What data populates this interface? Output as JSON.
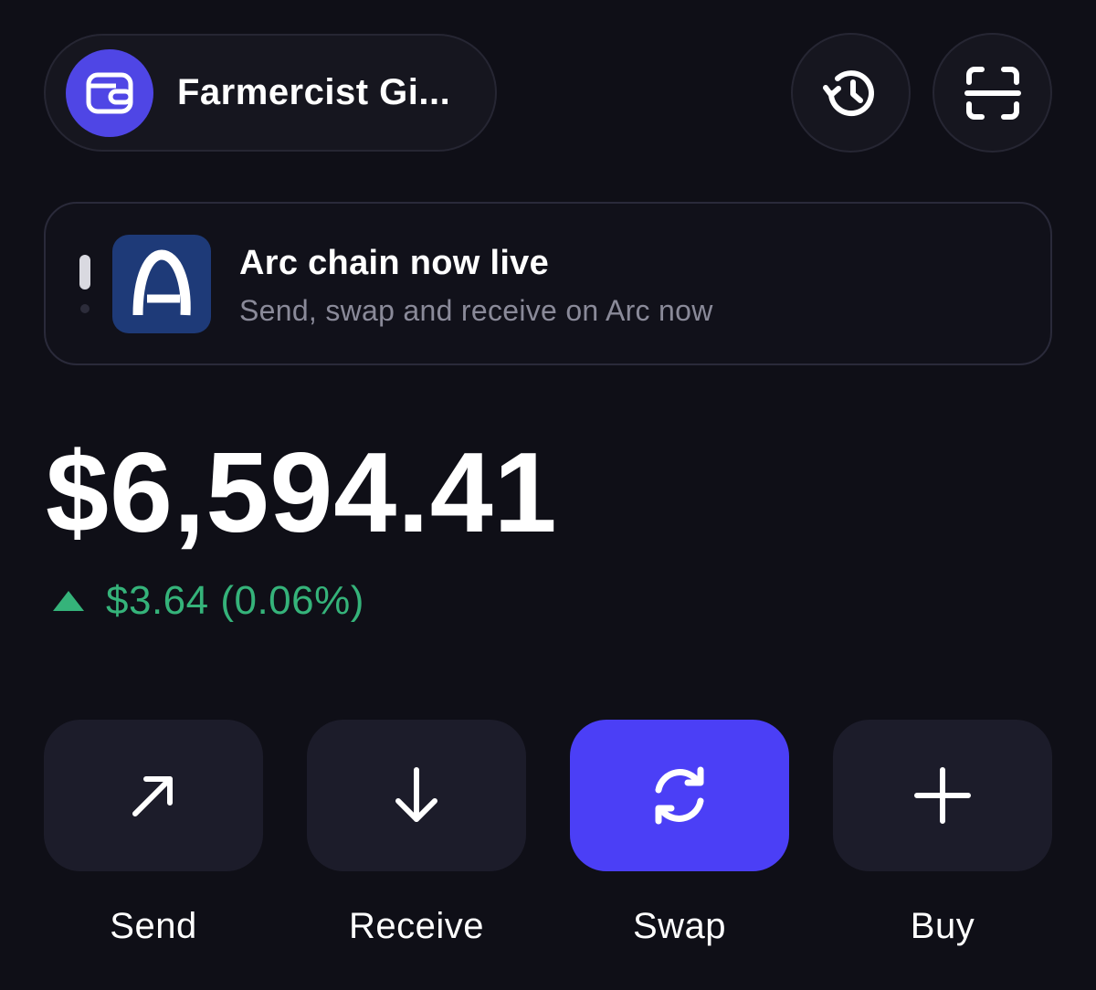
{
  "account": {
    "name": "Farmercist Gi...",
    "avatar_icon": "wallet-icon",
    "avatar_color": "#4f46e5"
  },
  "header": {
    "history_icon": "history-icon",
    "scan_icon": "scan-icon"
  },
  "banner": {
    "title": "Arc chain now live",
    "subtitle": "Send, swap and receive on Arc now",
    "logo_icon": "arc-logo-icon",
    "logo_color": "#1e3a78"
  },
  "portfolio": {
    "balance": "$6,594.41",
    "change": "$3.64 (0.06%)",
    "change_direction": "up",
    "change_color": "#35b37a"
  },
  "actions": [
    {
      "label": "Send",
      "icon": "arrow-up-right-icon"
    },
    {
      "label": "Receive",
      "icon": "arrow-down-icon"
    },
    {
      "label": "Swap",
      "icon": "swap-icon",
      "highlight_color": "#4b3ff6"
    },
    {
      "label": "Buy",
      "icon": "plus-icon"
    }
  ]
}
